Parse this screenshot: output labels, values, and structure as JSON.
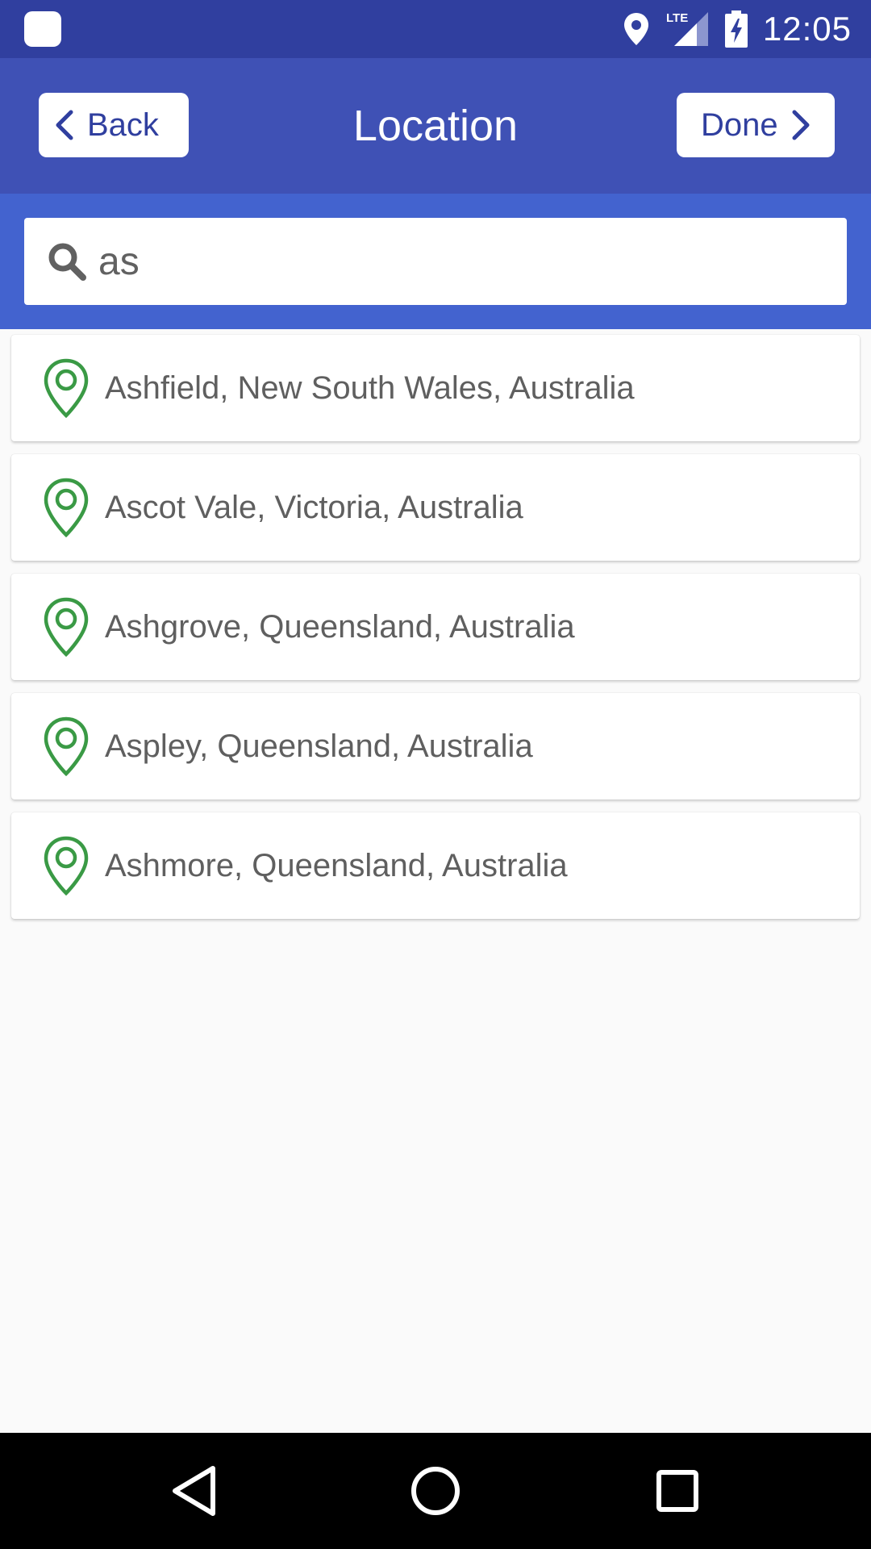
{
  "status_bar": {
    "time": "12:05",
    "network": "LTE",
    "icons": [
      "app-square-icon",
      "location-icon",
      "lte-signal-icon",
      "battery-charging-icon"
    ]
  },
  "header": {
    "title": "Location",
    "back_label": "Back",
    "done_label": "Done"
  },
  "search": {
    "value": "as"
  },
  "results": [
    {
      "label": "Ashfield, New South Wales, Australia"
    },
    {
      "label": "Ascot Vale, Victoria, Australia"
    },
    {
      "label": "Ashgrove, Queensland, Australia"
    },
    {
      "label": "Aspley, Queensland, Australia"
    },
    {
      "label": "Ashmore, Queensland, Australia"
    }
  ],
  "nav_bar": {
    "icons": [
      "back-triangle-icon",
      "home-circle-icon",
      "recents-square-icon"
    ]
  },
  "colors": {
    "status_bar": "#303f9f",
    "header": "#3f51b5",
    "search_band": "#4363cf",
    "pin": "#3a9a45",
    "background": "#fafafa"
  }
}
